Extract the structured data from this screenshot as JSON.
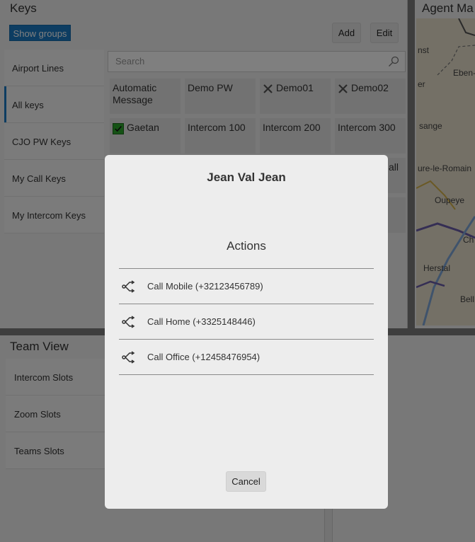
{
  "keys_panel": {
    "title": "Keys",
    "show_groups_label": "Show groups",
    "add_label": "Add",
    "edit_label": "Edit",
    "groups": [
      "Airport Lines",
      "All keys",
      "CJO PW Keys",
      "My Call Keys",
      "My Intercom Keys"
    ],
    "search_placeholder": "Search",
    "keys": [
      {
        "label": "Automatic Message",
        "icon": "none"
      },
      {
        "label": "Demo PW",
        "icon": "none"
      },
      {
        "label": "Demo01",
        "icon": "x-icon"
      },
      {
        "label": "Demo02",
        "icon": "x-icon"
      },
      {
        "label": "Gaetan",
        "icon": "check-icon"
      },
      {
        "label": "Intercom 100",
        "icon": "none"
      },
      {
        "label": "Intercom 200",
        "icon": "none"
      },
      {
        "label": "Intercom 300",
        "icon": "none"
      }
    ],
    "partial_key_label": "all"
  },
  "map_panel": {
    "title": "Agent Ma",
    "labels": [
      "nst",
      "Eben-",
      "er",
      "sange",
      "ure-le-Romain",
      "Oupeye",
      "Ch",
      "Herstal",
      "Bell"
    ]
  },
  "team_panel": {
    "title": "Team View",
    "slots": [
      "Intercom Slots",
      "Zoom Slots",
      "Teams Slots"
    ]
  },
  "dialog": {
    "title": "Jean Val Jean",
    "section_title": "Actions",
    "actions": [
      {
        "label": "Call Mobile (+32123456789)",
        "icon": "call-split-icon"
      },
      {
        "label": "Call Home (+3325148446)",
        "icon": "call-split-icon"
      },
      {
        "label": "Call Office (+12458476954)",
        "icon": "call-split-icon"
      }
    ],
    "cancel_label": "Cancel"
  },
  "colors": {
    "accent": "#1b7bc4",
    "overlay": "#000000",
    "check": "#2aa42a"
  }
}
